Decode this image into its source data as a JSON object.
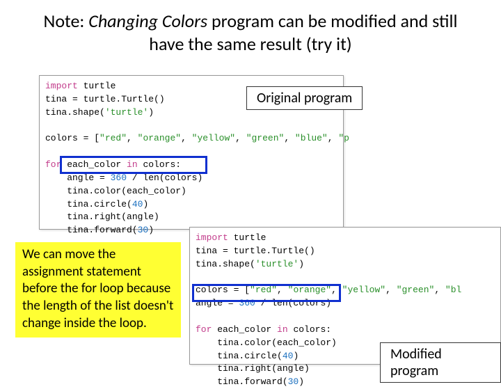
{
  "title": {
    "prefix": "Note: ",
    "italic": "Changing Colors",
    "rest": " program can be modified and still have the same result (try it)"
  },
  "label_original": "Original program",
  "label_modified": "Modified program",
  "note": "We can move the assignment statement before the for loop because the length of the list doesn't change inside the loop.",
  "code_original": {
    "l1a": "import",
    "l1b": " turtle",
    "l2": "tina = turtle.Turtle()",
    "l3a": "tina.shape(",
    "l3b": "'turtle'",
    "l3c": ")",
    "l4a": "colors = [",
    "l4b": "\"red\"",
    "l4c": ", ",
    "l4d": "\"orange\"",
    "l4e": ", ",
    "l4f": "\"yellow\"",
    "l4g": ", ",
    "l4h": "\"green\"",
    "l4i": ", ",
    "l4j": "\"blue\"",
    "l4k": ", ",
    "l4l": "\"p",
    "l5a": "for",
    "l5b": " each_color ",
    "l5c": "in",
    "l5d": " colors:",
    "l6a": "    angle = ",
    "l6b": "360",
    "l6c": " / len(colors)",
    "l7": "    tina.color(each_color)",
    "l8a": "    tina.circle(",
    "l8b": "40",
    "l8c": ")",
    "l9": "    tina.right(angle)",
    "l10a": "    tina.forward(",
    "l10b": "30",
    "l10c": ")"
  },
  "code_modified": {
    "l1a": "import",
    "l1b": " turtle",
    "l2": "tina = turtle.Turtle()",
    "l3a": "tina.shape(",
    "l3b": "'turtle'",
    "l3c": ")",
    "l4a": "colors = [",
    "l4b": "\"red\"",
    "l4c": ", ",
    "l4d": "\"orange\"",
    "l4e": ", ",
    "l4f": "\"yellow\"",
    "l4g": ", ",
    "l4h": "\"green\"",
    "l4i": ", ",
    "l4j": "\"bl",
    "l5a": "angle = ",
    "l5b": "360",
    "l5c": " / len(colors)",
    "l6a": "for",
    "l6b": " each_color ",
    "l6c": "in",
    "l6d": " colors:",
    "l7": "    tina.color(each_color)",
    "l8a": "    tina.circle(",
    "l8b": "40",
    "l8c": ")",
    "l9": "    tina.right(angle)",
    "l10a": "    tina.forward(",
    "l10b": "30",
    "l10c": ")"
  }
}
